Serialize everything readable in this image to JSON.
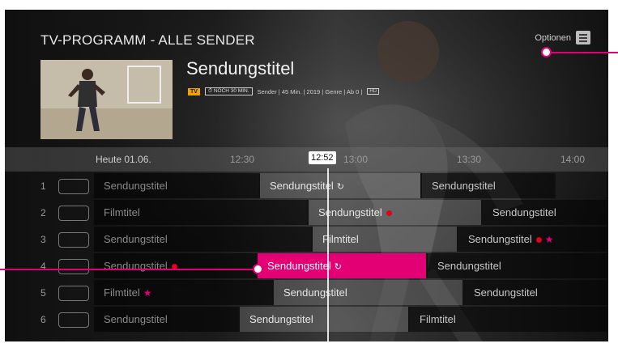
{
  "header": {
    "title": "TV-PROGRAMM - ALLE SENDER",
    "options_label": "Optionen"
  },
  "program": {
    "title": "Sendungstitel",
    "tv_badge": "TV",
    "time_badge": "⏱ NOCH 30 MIN.",
    "meta": "Sender  |  45 Min.  |  2019  |  Genre  |  Ab 0  |",
    "hd_badge": "HD"
  },
  "timeline": {
    "day_label": "Heute 01.06.",
    "ticks": [
      "12:30",
      "13:00",
      "13:30",
      "14:00"
    ],
    "now": "12:52"
  },
  "accent_color": "#e20074",
  "rows": [
    {
      "channel": "1",
      "cells": [
        {
          "title": "Sendungstitel",
          "state": "past"
        },
        {
          "title": "Sendungstitel",
          "state": "cur",
          "icon": "replay-icon"
        },
        {
          "title": "Sendungstitel",
          "state": "fut"
        }
      ]
    },
    {
      "channel": "2",
      "cells": [
        {
          "title": "Filmtitel",
          "state": "past"
        },
        {
          "title": "Sendungstitel",
          "state": "cur",
          "icon": "record-dot-icon"
        },
        {
          "title": "Sendungstitel",
          "state": "fut"
        }
      ]
    },
    {
      "channel": "3",
      "cells": [
        {
          "title": "Sendungstitel",
          "state": "past"
        },
        {
          "title": "Filmtitel",
          "state": "cur"
        },
        {
          "title": "Sendungstitel",
          "state": "fut",
          "icon": "record-dot-star-icon"
        }
      ]
    },
    {
      "channel": "4",
      "cells": [
        {
          "title": "Sendungstitel",
          "state": "past",
          "icon": "record-dot-icon"
        },
        {
          "title": "Sendungstitel",
          "state": "sel",
          "icon": "replay-icon"
        },
        {
          "title": "Sendungstitel",
          "state": "fut"
        }
      ]
    },
    {
      "channel": "5",
      "cells": [
        {
          "title": "Filmtitel",
          "state": "past",
          "icon": "star-icon"
        },
        {
          "title": "Sendungstitel",
          "state": "cur"
        },
        {
          "title": "Sendungstitel",
          "state": "fut"
        }
      ]
    },
    {
      "channel": "6",
      "cells": [
        {
          "title": "Sendungstitel",
          "state": "past"
        },
        {
          "title": "Sendungstitel",
          "state": "cur"
        },
        {
          "title": "Filmtitel",
          "state": "fut"
        }
      ]
    }
  ]
}
